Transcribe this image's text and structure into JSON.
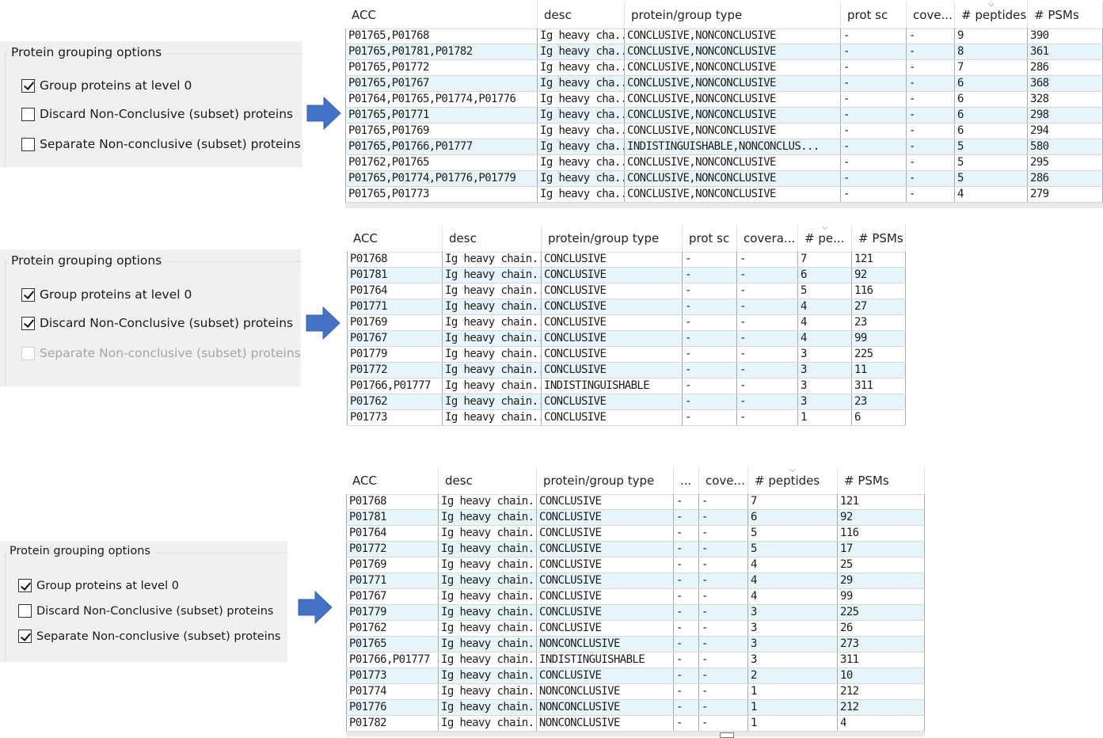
{
  "option_label": "Protein grouping options",
  "panels": [
    {
      "options": [
        {
          "label": "Group proteins at level 0",
          "checked": true,
          "disabled": false
        },
        {
          "label": "Discard Non-Conclusive (subset) proteins",
          "checked": false,
          "disabled": false
        },
        {
          "label": "Separate Non-conclusive (subset) proteins",
          "checked": false,
          "disabled": false
        }
      ],
      "table": {
        "headers": [
          "ACC",
          "desc",
          "protein/group type",
          "prot sc",
          "cove...",
          "# peptides",
          "# PSMs"
        ],
        "sort_column": 5,
        "rows": [
          [
            "P01765,P01768",
            "Ig heavy cha...",
            "CONCLUSIVE,NONCONCLUSIVE",
            "-",
            "-",
            "9",
            "390"
          ],
          [
            "P01765,P01781,P01782",
            "Ig heavy cha...",
            "CONCLUSIVE,NONCONCLUSIVE",
            "-",
            "-",
            "8",
            "361"
          ],
          [
            "P01765,P01772",
            "Ig heavy cha...",
            "CONCLUSIVE,NONCONCLUSIVE",
            "-",
            "-",
            "7",
            "286"
          ],
          [
            "P01765,P01767",
            "Ig heavy cha...",
            "CONCLUSIVE,NONCONCLUSIVE",
            "-",
            "-",
            "6",
            "368"
          ],
          [
            "P01764,P01765,P01774,P01776",
            "Ig heavy cha...",
            "CONCLUSIVE,NONCONCLUSIVE",
            "-",
            "-",
            "6",
            "328"
          ],
          [
            "P01765,P01771",
            "Ig heavy cha...",
            "CONCLUSIVE,NONCONCLUSIVE",
            "-",
            "-",
            "6",
            "298"
          ],
          [
            "P01765,P01769",
            "Ig heavy cha...",
            "CONCLUSIVE,NONCONCLUSIVE",
            "-",
            "-",
            "6",
            "294"
          ],
          [
            "P01765,P01766,P01777",
            "Ig heavy cha...",
            "INDISTINGUISHABLE,NONCONCLUS...",
            "-",
            "-",
            "5",
            "580"
          ],
          [
            "P01762,P01765",
            "Ig heavy cha...",
            "CONCLUSIVE,NONCONCLUSIVE",
            "-",
            "-",
            "5",
            "295"
          ],
          [
            "P01765,P01774,P01776,P01779",
            "Ig heavy cha...",
            "CONCLUSIVE,NONCONCLUSIVE",
            "-",
            "-",
            "5",
            "286"
          ],
          [
            "P01765,P01773",
            "Ig heavy cha...",
            "CONCLUSIVE,NONCONCLUSIVE",
            "-",
            "-",
            "4",
            "279"
          ]
        ]
      }
    },
    {
      "options": [
        {
          "label": "Group proteins at level 0",
          "checked": true,
          "disabled": false
        },
        {
          "label": "Discard Non-Conclusive (subset) proteins",
          "checked": true,
          "disabled": false
        },
        {
          "label": "Separate Non-conclusive (subset) proteins",
          "checked": false,
          "disabled": true
        }
      ],
      "table": {
        "headers": [
          "ACC",
          "desc",
          "protein/group type",
          "prot sc",
          "covera...",
          "# pe...",
          "# PSMs"
        ],
        "sort_column": 5,
        "rows": [
          [
            "P01768",
            "Ig heavy chain...",
            "CONCLUSIVE",
            "-",
            "-",
            "7",
            "121"
          ],
          [
            "P01781",
            "Ig heavy chain...",
            "CONCLUSIVE",
            "-",
            "-",
            "6",
            "92"
          ],
          [
            "P01764",
            "Ig heavy chain...",
            "CONCLUSIVE",
            "-",
            "-",
            "5",
            "116"
          ],
          [
            "P01771",
            "Ig heavy chain...",
            "CONCLUSIVE",
            "-",
            "-",
            "4",
            "27"
          ],
          [
            "P01769",
            "Ig heavy chain...",
            "CONCLUSIVE",
            "-",
            "-",
            "4",
            "23"
          ],
          [
            "P01767",
            "Ig heavy chain...",
            "CONCLUSIVE",
            "-",
            "-",
            "4",
            "99"
          ],
          [
            "P01779",
            "Ig heavy chain...",
            "CONCLUSIVE",
            "-",
            "-",
            "3",
            "225"
          ],
          [
            "P01772",
            "Ig heavy chain...",
            "CONCLUSIVE",
            "-",
            "-",
            "3",
            "11"
          ],
          [
            "P01766,P01777",
            "Ig heavy chain...",
            "INDISTINGUISHABLE",
            "-",
            "-",
            "3",
            "311"
          ],
          [
            "P01762",
            "Ig heavy chain...",
            "CONCLUSIVE",
            "-",
            "-",
            "3",
            "23"
          ],
          [
            "P01773",
            "Ig heavy chain...",
            "CONCLUSIVE",
            "-",
            "-",
            "1",
            "6"
          ]
        ]
      }
    },
    {
      "options": [
        {
          "label": "Group proteins at level 0",
          "checked": true,
          "disabled": false
        },
        {
          "label": "Discard Non-Conclusive (subset) proteins",
          "checked": false,
          "disabled": false
        },
        {
          "label": "Separate Non-conclusive (subset) proteins",
          "checked": true,
          "disabled": false
        }
      ],
      "table": {
        "headers": [
          "ACC",
          "desc",
          "protein/group type",
          "...",
          "cove...",
          "# peptides",
          "# PSMs"
        ],
        "sort_column": 5,
        "rows": [
          [
            "P01768",
            "Ig heavy chain...",
            "CONCLUSIVE",
            "-",
            "-",
            "7",
            "121"
          ],
          [
            "P01781",
            "Ig heavy chain...",
            "CONCLUSIVE",
            "-",
            "-",
            "6",
            "92"
          ],
          [
            "P01764",
            "Ig heavy chain...",
            "CONCLUSIVE",
            "-",
            "-",
            "5",
            "116"
          ],
          [
            "P01772",
            "Ig heavy chain...",
            "CONCLUSIVE",
            "-",
            "-",
            "5",
            "17"
          ],
          [
            "P01769",
            "Ig heavy chain...",
            "CONCLUSIVE",
            "-",
            "-",
            "4",
            "25"
          ],
          [
            "P01771",
            "Ig heavy chain...",
            "CONCLUSIVE",
            "-",
            "-",
            "4",
            "29"
          ],
          [
            "P01767",
            "Ig heavy chain...",
            "CONCLUSIVE",
            "-",
            "-",
            "4",
            "99"
          ],
          [
            "P01779",
            "Ig heavy chain...",
            "CONCLUSIVE",
            "-",
            "-",
            "3",
            "225"
          ],
          [
            "P01762",
            "Ig heavy chain...",
            "CONCLUSIVE",
            "-",
            "-",
            "3",
            "26"
          ],
          [
            "P01765",
            "Ig heavy chain...",
            "NONCONCLUSIVE",
            "-",
            "-",
            "3",
            "273"
          ],
          [
            "P01766,P01777",
            "Ig heavy chain...",
            "INDISTINGUISHABLE",
            "-",
            "-",
            "3",
            "311"
          ],
          [
            "P01773",
            "Ig heavy chain...",
            "CONCLUSIVE",
            "-",
            "-",
            "2",
            "10"
          ],
          [
            "P01774",
            "Ig heavy chain...",
            "NONCONCLUSIVE",
            "-",
            "-",
            "1",
            "212"
          ],
          [
            "P01776",
            "Ig heavy chain...",
            "NONCONCLUSIVE",
            "-",
            "-",
            "1",
            "212"
          ],
          [
            "P01782",
            "Ig heavy chain...",
            "NONCONCLUSIVE",
            "-",
            "-",
            "1",
            "4"
          ]
        ]
      }
    }
  ],
  "colors": {
    "arrow": "#4472c4",
    "row_alt": "#e6f4fb",
    "panel_bg": "#f0f0f0"
  },
  "icons": {
    "arrow": "right-arrow-icon",
    "sort": "sort-descending-icon",
    "checkbox": "checkbox-icon"
  }
}
